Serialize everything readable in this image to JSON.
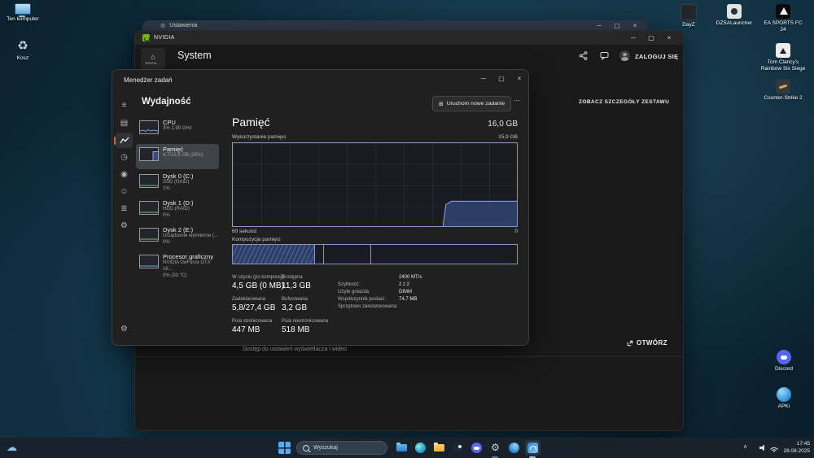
{
  "colors": {
    "memory_accent": "#8d93ce",
    "memory_fill": "#2c3d66",
    "nvidia_green": "#76b900",
    "rail_accent": "#c96a39",
    "selection_bg": "#3f434a"
  },
  "icons": {
    "minimize": "─",
    "maximize": "▢",
    "close": "×",
    "menu": "≡",
    "processes": "▤",
    "app_history": "◷",
    "startup_apps": "◉",
    "users": "☺",
    "details": "≣",
    "services": "⚙",
    "settings_gear": "⚙",
    "home": "⌂",
    "more": "…",
    "chevron_up": "∧",
    "new_task": "⊞",
    "weather_cloud": "☁",
    "recycle": "♻"
  },
  "desktop": {
    "icons": [
      {
        "label": "Ten komputer"
      },
      {
        "label": "Kosz"
      },
      {
        "label": "DayZ"
      },
      {
        "label": "DZSALauncher"
      },
      {
        "label": "EA SPORTS FC 24"
      },
      {
        "label": "Tom Clancy's Rainbow Six Siege"
      },
      {
        "label": "Counter-Strike 2"
      },
      {
        "label": "Discord"
      },
      {
        "label": "APKi"
      }
    ]
  },
  "settings_window": {
    "title": "Ustawienia"
  },
  "nvidia": {
    "title": "NVIDIA",
    "home_label": "Strona ...",
    "page_title": "System",
    "login_label": "ZALOGUJ SIĘ",
    "details_link": "ZOBACZ SZCZEGÓŁY ZESTAWU",
    "open_button": "OTWÓRZ",
    "footer_text": "Dostęp do ustawień wyświetlacza i wideo"
  },
  "task_manager": {
    "window_title": "Menedżer zadań",
    "page_title": "Wydajność",
    "run_new_task": "Uruchom nowe zadanie",
    "perf_items": [
      {
        "name": "CPU",
        "line1": "3% 1,99 GHz"
      },
      {
        "name": "Pamięć",
        "line1": "4,7/15,9 GB (30%)"
      },
      {
        "name": "Dysk 0 (C:)",
        "line1": "SSD (RAID)",
        "line2": "1%"
      },
      {
        "name": "Dysk 1 (D:)",
        "line1": "HDD (RAID)",
        "line2": "0%"
      },
      {
        "name": "Dysk 2 (E:)",
        "line1": "Urządzenie wymienne (...",
        "line2": "0%"
      },
      {
        "name": "Procesor graficzny",
        "line1": "NVIDIA GeForce GTX 16...",
        "line2": "0% (33 °C)"
      }
    ],
    "memory": {
      "title": "Pamięć",
      "total": "16,0 GB",
      "usage_label": "Wykorzystanie pamięci",
      "scale_top": "15,9 GB",
      "axis_left": "60 sekund",
      "axis_right": "0",
      "composition_label": "Kompozycja pamięci",
      "stats": [
        {
          "label": "W użyciu (po kompresji)",
          "value": "4,5 GB (0 MB)"
        },
        {
          "label": "Dostępna",
          "value": "11,3 GB"
        },
        {
          "label": "Zadeklarowana",
          "value": "5,8/27,4 GB"
        },
        {
          "label": "Buforowana",
          "value": "3,2 GB"
        },
        {
          "label": "Pula stronicowana",
          "value": "447 MB"
        },
        {
          "label": "Pula niestronicowana",
          "value": "518 MB"
        }
      ],
      "details": [
        {
          "label": "Szybkość:",
          "value": "2400 MT/s"
        },
        {
          "label": "Użyte gniazda:",
          "value": "2 z 2"
        },
        {
          "label": "Współczynnik postaci:",
          "value": "DIMM"
        },
        {
          "label": "Sprzętowo zarezerwowana:",
          "value": "74,7 MB"
        }
      ]
    }
  },
  "taskbar": {
    "search_placeholder": "Wyszukaj",
    "apps": [
      "file-explorer",
      "edge",
      "folder",
      "steam",
      "discord",
      "settings",
      "browser",
      "task-manager"
    ],
    "clock": {
      "time": "17:45",
      "date": "28.08.2025"
    }
  },
  "chart_data": {
    "type": "area",
    "title": "Wykorzystanie pamięci",
    "xlabel_left": "60 sekund",
    "xlabel_right": "0",
    "ylabel_top": "15,9 GB",
    "y_max_gb": 15.9,
    "x_range_seconds": 60,
    "usage_pct_points": [
      [
        74,
        0
      ],
      [
        75,
        26
      ],
      [
        77,
        30
      ],
      [
        100,
        30
      ]
    ],
    "composition_segments": [
      {
        "name": "in-use",
        "pct": 28.8,
        "filled": true
      },
      {
        "name": "modified",
        "pct": 3.4,
        "filled": false
      },
      {
        "name": "standby",
        "pct": 16.5,
        "filled": false
      },
      {
        "name": "free",
        "pct": 51.3,
        "filled": false
      }
    ],
    "accent_color": "#8d93ce"
  }
}
